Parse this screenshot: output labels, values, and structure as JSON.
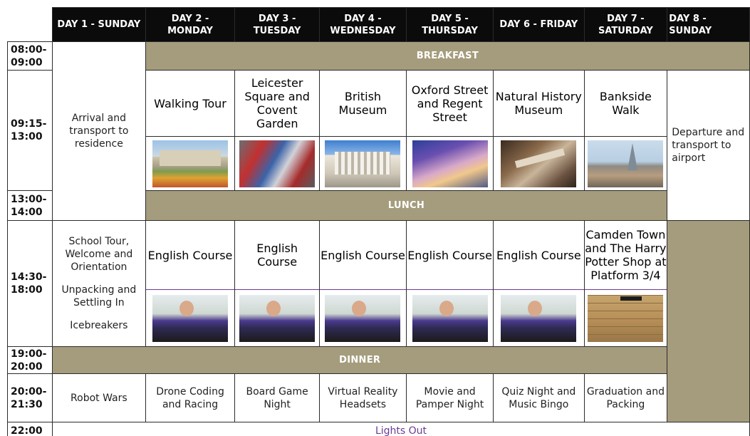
{
  "days": [
    "DAY 1 - SUNDAY",
    "DAY 2 - MONDAY",
    "DAY 3 - TUESDAY",
    "DAY 4 - WEDNESDAY",
    "DAY 5 - THURSDAY",
    "DAY 6 - FRIDAY",
    "DAY 7 - SATURDAY",
    "DAY 8 - SUNDAY"
  ],
  "times": [
    "08:00-09:00",
    "09:15-13:00",
    "13:00-14:00",
    "14:30-18:00",
    "19:00-20:00",
    "20:00-21:30",
    "22:00"
  ],
  "bands": {
    "breakfast": "BREAKFAST",
    "lunch": "LUNCH",
    "dinner": "DINNER"
  },
  "day1": {
    "arrival": "Arrival and transport to residence",
    "afternoon": [
      "School Tour, Welcome and Orientation",
      "Unpacking and Settling In",
      "Icebreakers"
    ]
  },
  "morning": [
    "Walking Tour",
    "Leicester Square and Covent Garden",
    "British Museum",
    "Oxford Street and Regent Street",
    "Natural History Museum",
    "Bankside Walk"
  ],
  "afternoon": [
    "English Course",
    "English Course",
    "English Course",
    "English Course",
    "English Course",
    "Camden Town and The Harry Potter Shop at Platform 3/4"
  ],
  "evening": [
    "Robot Wars",
    "Drone Coding and Racing",
    "Board Game Night",
    "Virtual Reality Headsets",
    "Movie and Pamper Night",
    "Quiz Night and Music Bingo",
    "Graduation and Packing"
  ],
  "departure": "Departure and transport to airport",
  "lights_out": "Lights Out",
  "photos": {
    "morning": [
      "buckingham-palace-photo",
      "piccadilly-circus-photo",
      "british-museum-photo",
      "regent-street-photo",
      "natural-history-museum-photo",
      "bankside-shard-photo"
    ],
    "afternoon": [
      "classroom-photo",
      "classroom-photo",
      "classroom-photo",
      "classroom-photo",
      "classroom-photo",
      "platform-9-3-4-photo"
    ]
  },
  "colors": {
    "header": "#0b0b0b",
    "band": "#a59c7d",
    "accent": "#6a3d94"
  }
}
